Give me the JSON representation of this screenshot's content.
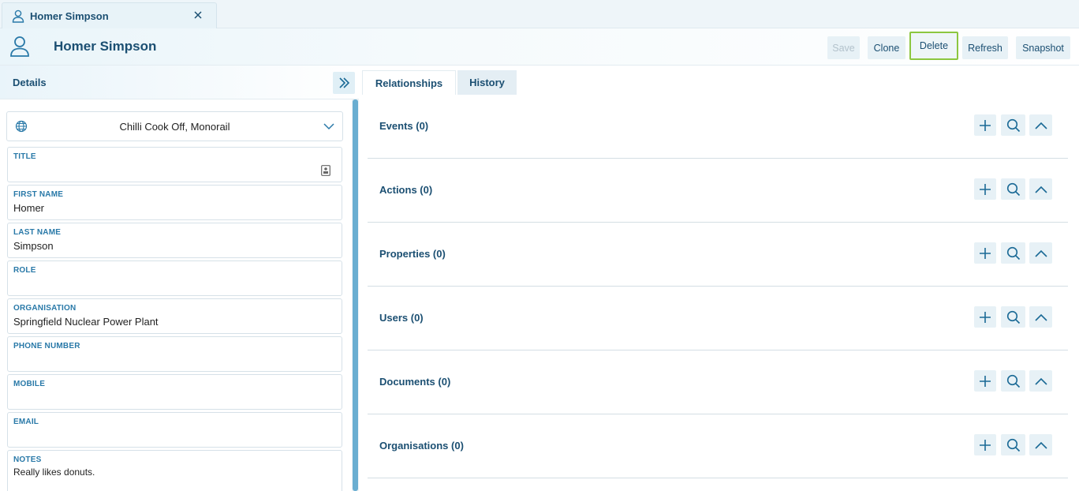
{
  "tab": {
    "title": "Homer Simpson"
  },
  "header": {
    "title": "Homer Simpson"
  },
  "toolbar": {
    "save": "Save",
    "clone": "Clone",
    "delete": "Delete",
    "refresh": "Refresh",
    "snapshot": "Snapshot"
  },
  "details": {
    "heading": "Details",
    "incident": "Chilli Cook Off, Monorail",
    "fields": [
      {
        "label": "TITLE",
        "value": ""
      },
      {
        "label": "FIRST NAME",
        "value": "Homer"
      },
      {
        "label": "LAST NAME",
        "value": "Simpson"
      },
      {
        "label": "ROLE",
        "value": ""
      },
      {
        "label": "ORGANISATION",
        "value": "Springfield Nuclear Power Plant"
      },
      {
        "label": "PHONE NUMBER",
        "value": ""
      },
      {
        "label": "MOBILE",
        "value": ""
      },
      {
        "label": "EMAIL",
        "value": ""
      },
      {
        "label": "NOTES",
        "value": "Really likes donuts."
      }
    ]
  },
  "rel_tabs": [
    {
      "label": "Relationships",
      "active": true
    },
    {
      "label": "History",
      "active": false
    }
  ],
  "sections": [
    {
      "title": "Events (0)"
    },
    {
      "title": "Actions (0)"
    },
    {
      "title": "Properties (0)"
    },
    {
      "title": "Users (0)"
    },
    {
      "title": "Documents (0)"
    },
    {
      "title": "Organisations (0)"
    }
  ],
  "colors": {
    "accent": "#1b4f72",
    "label": "#2979a8",
    "focus": "#8cc63f",
    "scroll": "#6aaed1"
  }
}
